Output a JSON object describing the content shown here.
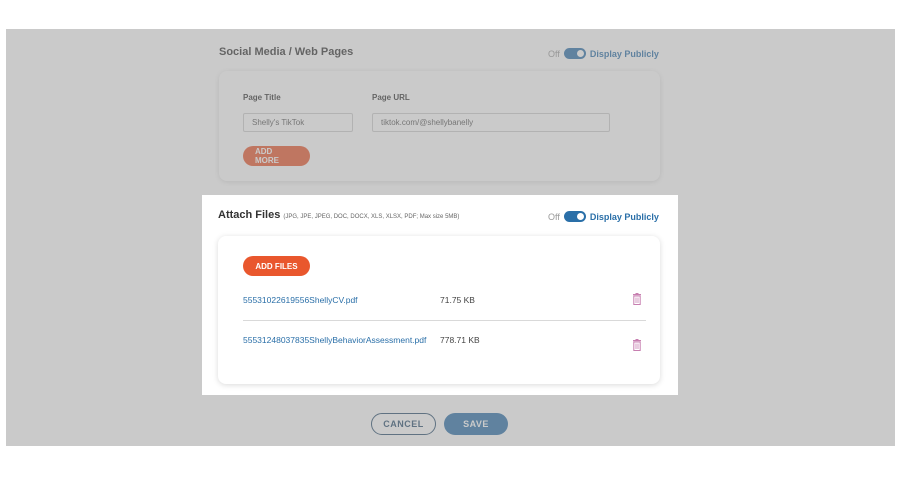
{
  "social": {
    "title": "Social Media / Web Pages",
    "toggle_off": "Off",
    "toggle_on": "Display Publicly",
    "page_title_label": "Page Title",
    "page_url_label": "Page URL",
    "page_title_value": "Shelly's TikTok",
    "page_url_value": "tiktok.com/@shellybanelly",
    "add_more_label": "ADD MORE"
  },
  "attach": {
    "title": "Attach Files",
    "hint": "(JPG, JPE, JPEG, DOC, DOCX, XLS, XLSX, PDF; Max size 5MB)",
    "toggle_off": "Off",
    "toggle_on": "Display Publicly",
    "add_files_label": "ADD FILES",
    "files": [
      {
        "name": "55531022619556ShellyCV.pdf",
        "size": "71.75 KB"
      },
      {
        "name": "55531248037835ShellyBehaviorAssessment.pdf",
        "size": "778.71 KB"
      }
    ]
  },
  "actions": {
    "cancel_label": "CANCEL",
    "save_label": "SAVE"
  },
  "colors": {
    "accent_orange": "#e9572d",
    "accent_blue": "#2a6fa8",
    "overlay": "#969696"
  }
}
